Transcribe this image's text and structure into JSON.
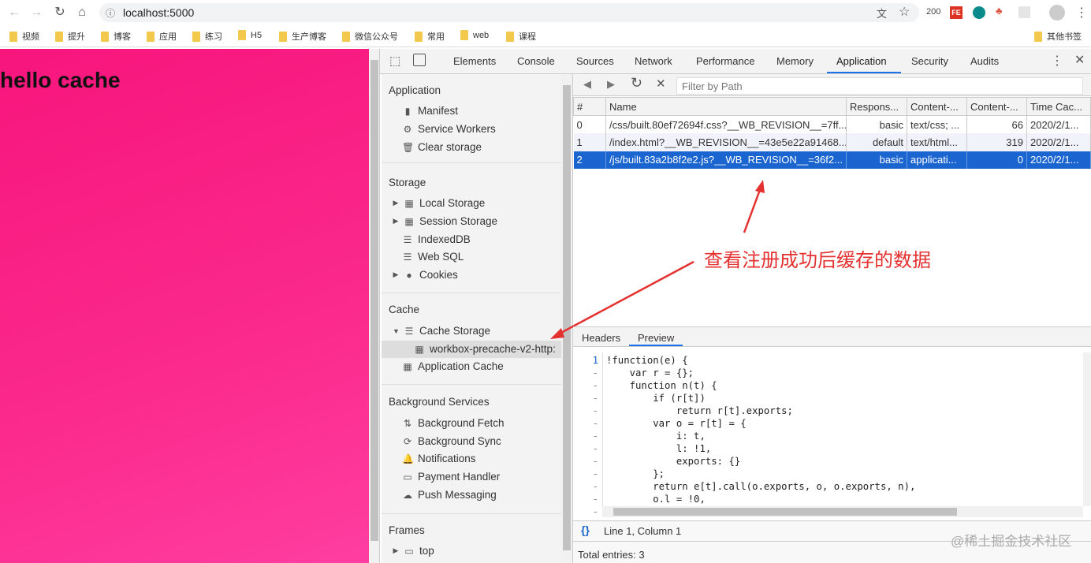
{
  "browser": {
    "url": "localhost:5000",
    "ext_badge": "200",
    "ext_fe": "FE",
    "bookmarks": [
      "视频",
      "提升",
      "博客",
      "应用",
      "练习",
      "H5",
      "生产博客",
      "微信公众号",
      "常用",
      "web",
      "课程"
    ],
    "other_bookmarks": "其他书签"
  },
  "page": {
    "heading": "hello cache"
  },
  "devtools": {
    "tabs": [
      "Elements",
      "Console",
      "Sources",
      "Network",
      "Performance",
      "Memory",
      "Application",
      "Security",
      "Audits"
    ],
    "active_tab": "Application"
  },
  "sidebar": {
    "application": {
      "title": "Application",
      "items": [
        "Manifest",
        "Service Workers",
        "Clear storage"
      ]
    },
    "storage": {
      "title": "Storage",
      "items": [
        "Local Storage",
        "Session Storage",
        "IndexedDB",
        "Web SQL",
        "Cookies"
      ]
    },
    "cache": {
      "title": "Cache",
      "items": [
        "Cache Storage",
        "workbox-precache-v2-http:",
        "Application Cache"
      ]
    },
    "background": {
      "title": "Background Services",
      "items": [
        "Background Fetch",
        "Background Sync",
        "Notifications",
        "Payment Handler",
        "Push Messaging"
      ]
    },
    "frames": {
      "title": "Frames",
      "items": [
        "top"
      ]
    }
  },
  "cache_view": {
    "filter_placeholder": "Filter by Path",
    "columns": [
      "#",
      "Name",
      "Respons...",
      "Content-...",
      "Content-...",
      "Time Cac..."
    ],
    "rows": [
      [
        "0",
        "/css/built.80ef72694f.css?__WB_REVISION__=7ff...",
        "basic",
        "text/css; ...",
        "66",
        "2020/2/1..."
      ],
      [
        "1",
        "/index.html?__WB_REVISION__=43e5e22a91468...",
        "default",
        "text/html...",
        "319",
        "2020/2/1..."
      ],
      [
        "2",
        "/js/built.83a2b8f2e2.js?__WB_REVISION__=36f2...",
        "basic",
        "applicati...",
        "0",
        "2020/2/1..."
      ]
    ],
    "selected_row": 2
  },
  "annotation": "查看注册成功后缓存的数据",
  "preview": {
    "tabs": [
      "Headers",
      "Preview"
    ],
    "active": "Preview",
    "gutter": [
      "1",
      "-",
      "-",
      "-",
      "-",
      "-",
      "-",
      "-",
      "-",
      "-",
      "-",
      "-",
      "-"
    ],
    "lines": [
      "!function(e) {",
      "    var r = {};",
      "    function n(t) {",
      "        if (r[t])",
      "            return r[t].exports;",
      "        var o = r[t] = {",
      "            i: t,",
      "            l: !1,",
      "            exports: {}",
      "        };",
      "        return e[t].call(o.exports, o, o.exports, n),",
      "        o.l = !0,",
      ""
    ],
    "cursor": "Line 1, Column 1",
    "total": "Total entries: 3"
  },
  "watermark": "@稀土掘金技术社区"
}
